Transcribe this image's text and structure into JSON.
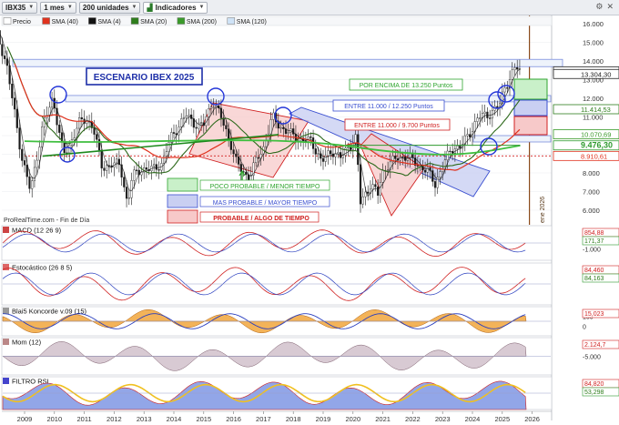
{
  "toolbar": {
    "symbol": "IBX35",
    "period": "1 mes",
    "units": "200 unidades",
    "indicators": "Indicadores"
  },
  "legend": [
    {
      "label": "Precio",
      "color": "#ffffff"
    },
    {
      "label": "SMA (40)",
      "color": "#e0321e"
    },
    {
      "label": "SMA (4)",
      "color": "#111111"
    },
    {
      "label": "SMA (20)",
      "color": "#2e7d1c"
    },
    {
      "label": "SMA (200)",
      "color": "#3a9a2a"
    },
    {
      "label": "SMA (120)",
      "color": "#cfe3f7"
    }
  ],
  "title_box": "ESCENARIO IBEX 2025",
  "scenario_labels": {
    "top": "POR ENCIMA DE 13.250 Puntos",
    "mid": "ENTRE 11.000 / 12.250 Puntos",
    "low": "ENTRE 11.000 / 9.700 Puntos"
  },
  "probability_legend": [
    {
      "label": "POCO PROBABLE / MENOR TIEMPO",
      "color": "#2fa52f",
      "fill": "#c9f0c9"
    },
    {
      "label": "MAS PROBABLE / MAYOR TIEMPO",
      "color": "#3a4fd0",
      "fill": "#c9cff2"
    },
    {
      "label": "PROBABLE / ALGO DE TIEMPO",
      "color": "#d02020",
      "fill": "#f7c9c9"
    }
  ],
  "source_note": "ProRealTime.com - Fin de Día",
  "vertical_note": "ene 2026",
  "price_axis": [
    "16.000",
    "15.000",
    "14.000",
    "13.000",
    "12.000",
    "11.000",
    "10.000",
    "9.000",
    "8.000",
    "7.000",
    "6.000"
  ],
  "price_badges": [
    {
      "label": "13.446,70",
      "color": "#222222"
    },
    {
      "label": "13.304,30",
      "color": "#222222"
    },
    {
      "label": "11.414,53",
      "color": "#2e7d1c"
    },
    {
      "label": "10.070,69",
      "color": "#3a9a2a"
    },
    {
      "label": "9.476,30",
      "color": "#2e9a2e"
    },
    {
      "label": "8.910,61",
      "color": "#e0321e"
    }
  ],
  "x_axis": [
    "2009",
    "2010",
    "2011",
    "2012",
    "2013",
    "2014",
    "2015",
    "2016",
    "2017",
    "2018",
    "2019",
    "2020",
    "2021",
    "2022",
    "2023",
    "2024",
    "2025",
    "2026"
  ],
  "panels": [
    {
      "title": "MACD (12 26 9)",
      "ticks": [
        "1.000",
        "-1.000"
      ],
      "badges": [
        "854,88",
        "171,37"
      ]
    },
    {
      "title": "Estocástico (26 8 5)",
      "ticks": [],
      "badges": [
        "84,460",
        "84,163"
      ]
    },
    {
      "title": "Blai5 Koncorde v.09 (15)",
      "ticks": [
        "100",
        "0"
      ],
      "badges": [
        "15,023"
      ]
    },
    {
      "title": "Mom (12)",
      "ticks": [
        "-5.000"
      ],
      "badges": [
        "2.124,7"
      ]
    },
    {
      "title": "FILTRO RSI",
      "ticks": [
        "0"
      ],
      "badges": [
        "84,820",
        "53,298"
      ]
    }
  ]
}
